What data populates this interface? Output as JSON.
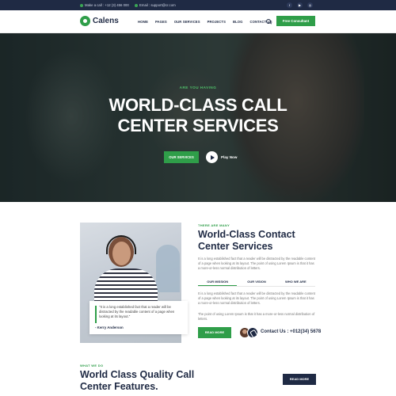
{
  "topbar": {
    "phone": "Make a call : +12 (3) 456 000",
    "email": "Email : support@cr.com",
    "social": [
      "facebook-icon",
      "youtube-icon",
      "instagram-icon"
    ]
  },
  "header": {
    "logo_text": "Calens",
    "nav": [
      "HOME",
      "PAGES",
      "OUR SERVICES",
      "PROJECTS",
      "BLOG",
      "CONTACT US"
    ],
    "cta_label": "Free Consultant"
  },
  "hero": {
    "kicker": "ARE YOU HAVING",
    "title_line1": "WORLD-CLASS CALL",
    "title_line2": "CENTER SERVICES",
    "button_label": "OUR SERVICES",
    "play_label": "Play Now"
  },
  "about": {
    "quote": "\"It is a long established fact that a reader will be distracted by the readable content of a page when looking at its layout.\"",
    "quote_author": "- Kerry Anderson",
    "kicker": "THERE ARE MANY",
    "title": "World-Class Contact Center Services",
    "para1": "It is a long established fact that a reader will be distracted by the readable content of a page when looking at its layout. The point of using Lorem Ipsum is that it has a more-or-less normal distribution of letters.",
    "tabs": [
      "OUR MISSION",
      "OUR VISION",
      "WHO WE ARE"
    ],
    "para2": "It is a long established fact that a reader will be distracted by the readable content of a page when looking at its layout. The point of using Lorem Ipsum is that it has a more-or-less normal distribution of letters.",
    "para3": "The point of using Lorem Ipsum is that it has a more-or-less normal distribution of letters.",
    "read_more_label": "READ MORE",
    "contact": "Contact Us : +012(34) 5678"
  },
  "features": {
    "kicker": "WHAT WE DO",
    "title": "World Class Quality Call Center Features.",
    "button_label": "READ MORE"
  },
  "colors": {
    "accent": "#2f9e49",
    "navy": "#1f2a44"
  }
}
